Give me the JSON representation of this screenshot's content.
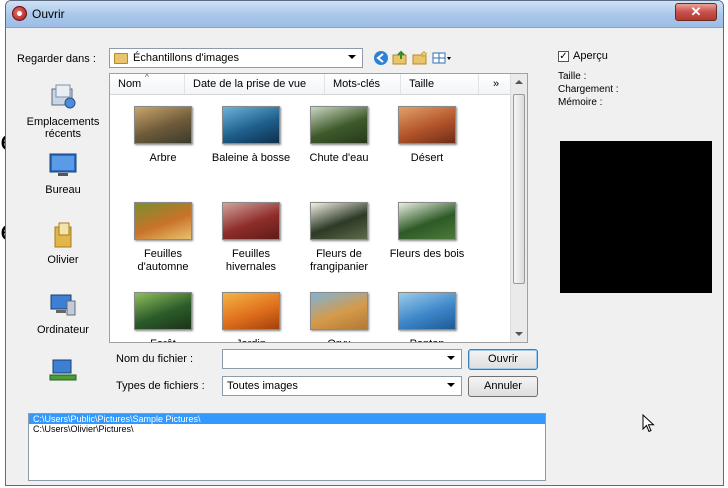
{
  "window": {
    "title": "Ouvrir",
    "close_label": "✕"
  },
  "look_in": {
    "label": "Regarder dans :",
    "value": "Échantillons d'images"
  },
  "toolbar": {
    "icons": [
      "back-icon",
      "up-folder-icon",
      "new-folder-icon",
      "view-menu-icon"
    ]
  },
  "places": [
    {
      "label": "Emplacements récents",
      "icon": "recent-places-icon"
    },
    {
      "label": "Bureau",
      "icon": "desktop-icon"
    },
    {
      "label": "Olivier",
      "icon": "user-folder-icon"
    },
    {
      "label": "Ordinateur",
      "icon": "computer-icon"
    },
    {
      "label": "",
      "icon": "network-icon"
    }
  ],
  "columns": [
    "Nom",
    "Date de la prise de vue",
    "Mots-clés",
    "Taille",
    "»"
  ],
  "files": [
    {
      "name": "Arbre",
      "colors": [
        "#6d5a3a",
        "#c9a56b",
        "#3b3a2c"
      ]
    },
    {
      "name": "Baleine à bosse",
      "colors": [
        "#1f5f8c",
        "#6bb3da",
        "#0d2f4d"
      ]
    },
    {
      "name": "Chute d'eau",
      "colors": [
        "#3e5a2a",
        "#c8d6c0",
        "#27381c"
      ]
    },
    {
      "name": "Désert",
      "colors": [
        "#b2542a",
        "#e3a069",
        "#6f2d17"
      ]
    },
    {
      "name": "Feuilles d'automne",
      "colors": [
        "#c9722a",
        "#7a8f2d",
        "#e8c26c"
      ]
    },
    {
      "name": "Feuilles hivernales",
      "colors": [
        "#8f2d2a",
        "#d0a39c",
        "#5e1b19"
      ]
    },
    {
      "name": "Fleurs de frangipanier",
      "colors": [
        "#2c3a26",
        "#f2efe4",
        "#5d6b4a"
      ]
    },
    {
      "name": "Fleurs des bois",
      "colors": [
        "#2d5a26",
        "#e9eee2",
        "#4c7a3b"
      ]
    },
    {
      "name": "Forêt",
      "colors": [
        "#2c5c2a",
        "#8fbf5a",
        "#1b3319"
      ]
    },
    {
      "name": "Jardin",
      "colors": [
        "#e0701c",
        "#f4b446",
        "#a3400d"
      ]
    },
    {
      "name": "Oryx",
      "colors": [
        "#d59a4a",
        "#7fb3d9",
        "#b07a36"
      ]
    },
    {
      "name": "Ponton",
      "colors": [
        "#3d87c9",
        "#9ccbea",
        "#1d5a95"
      ]
    }
  ],
  "filename": {
    "label": "Nom du fichier :",
    "value": "",
    "open_button": "Ouvrir"
  },
  "filetype": {
    "label": "Types de fichiers :",
    "value": "Toutes images",
    "cancel_button": "Annuler"
  },
  "paths": [
    {
      "text": "C:\\Users\\Public\\Pictures\\Sample Pictures\\",
      "selected": true
    },
    {
      "text": "C:\\Users\\Olivier\\Pictures\\",
      "selected": false
    }
  ],
  "preview": {
    "checkbox_label": "Aperçu",
    "checked": true,
    "size_label": "Taille :",
    "loading_label": "Chargement :",
    "memory_label": "Mémoire :"
  },
  "background_glyphs": [
    "e",
    "e"
  ]
}
